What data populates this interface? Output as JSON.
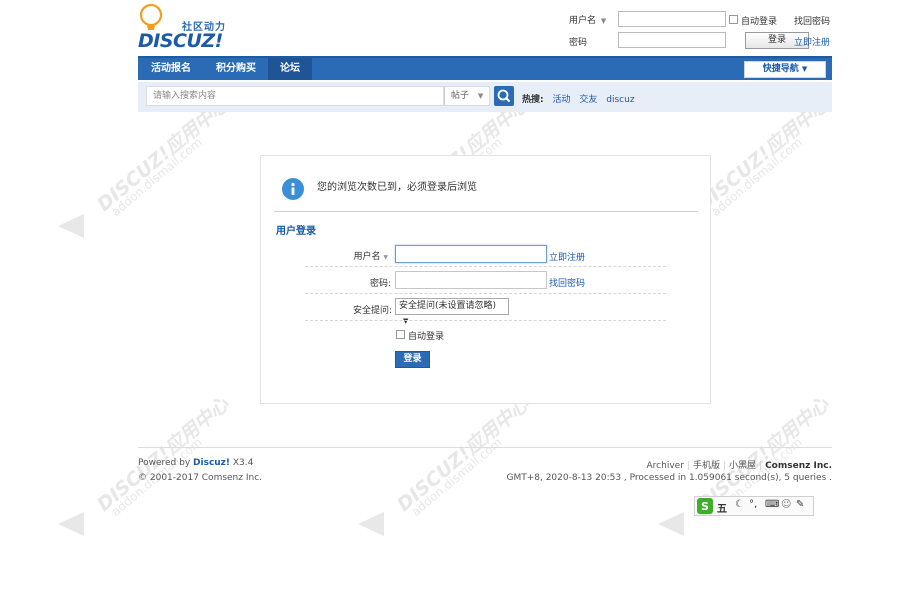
{
  "header": {
    "logo_tagline": "社区动力",
    "logo_word": "DISCUZ!",
    "username_label": "用户名",
    "password_label": "密码",
    "auto_login": "自动登录",
    "find_password": "找回密码",
    "login_button": "登录",
    "register": "立即注册"
  },
  "nav": {
    "items": [
      {
        "label": "活动报名"
      },
      {
        "label": "积分购买"
      },
      {
        "label": "论坛"
      }
    ],
    "quick_nav": "快捷导航"
  },
  "search": {
    "placeholder": "请输入搜索内容",
    "type": "帖子",
    "hot_label": "热搜:",
    "hot_terms": [
      "活动",
      "交友",
      "discuz"
    ]
  },
  "notice": {
    "message": "您的浏览次数已到，必须登录后浏览"
  },
  "login_form": {
    "title": "用户登录",
    "username_label": "用户名",
    "register_link": "立即注册",
    "password_label": "密码:",
    "find_password_link": "找回密码",
    "security_label": "安全提问:",
    "security_value": "安全提问(未设置请忽略)",
    "auto_login": "自动登录",
    "submit": "登录"
  },
  "footer": {
    "powered_by_prefix": "Powered by ",
    "powered_by_name": "Discuz!",
    "version": " X3.4",
    "copyright": "© 2001-2017 Comsenz Inc.",
    "links": [
      "Archiver",
      "手机版",
      "小黑屋",
      "Comsenz Inc."
    ],
    "stats": "GMT+8, 2020-8-13 20:53 , Processed in 1.059061 second(s), 5 queries ."
  },
  "ime": {
    "mode": "五"
  },
  "colors": {
    "brand": "#2b6bb5",
    "link": "#1a5aa9"
  }
}
